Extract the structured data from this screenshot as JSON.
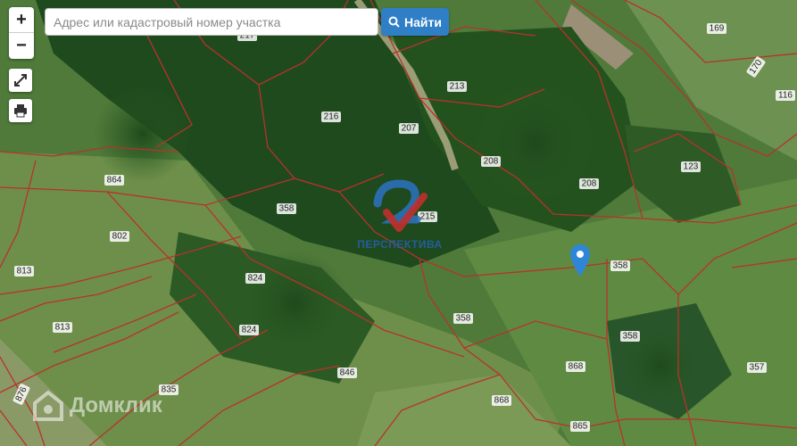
{
  "search": {
    "placeholder": "Адрес или кадастровый номер участка",
    "value": "",
    "button_label": "Найти"
  },
  "controls": {
    "zoom_in": "+",
    "zoom_out": "−"
  },
  "parcel_labels": {
    "l217": "217",
    "l213": "213",
    "l216": "216",
    "l207": "207",
    "l208a": "208",
    "l208b": "208",
    "l169": "169",
    "l170": "170",
    "l116": "116",
    "l123": "123",
    "l864": "864",
    "l358a": "358",
    "l215": "215",
    "l802": "802",
    "l813a": "813",
    "l824a": "824",
    "l358b": "358",
    "l358c": "358",
    "l824b": "824",
    "l813b": "813",
    "l358d": "358",
    "l846": "846",
    "l868a": "868",
    "l357": "357",
    "l835": "835",
    "l868b": "868",
    "l865": "865",
    "l876": "876"
  },
  "overlay": {
    "brand_name": "ПЕРСПЕКТИВА",
    "watermark": "Домклик"
  },
  "colors": {
    "boundary": "#b8322c",
    "button": "#2f7fc6",
    "pin": "#2f86d6",
    "brand": "#235d9c"
  }
}
